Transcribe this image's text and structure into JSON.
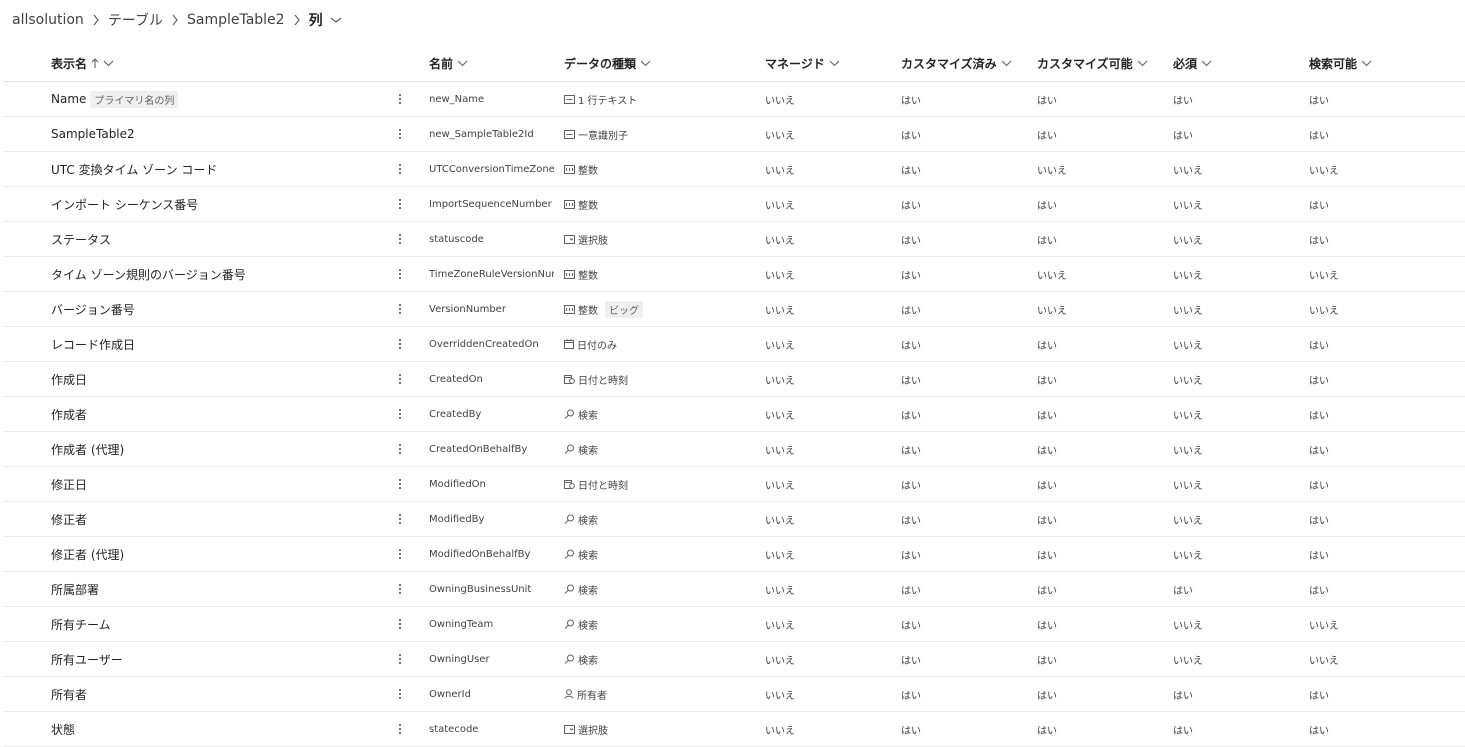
{
  "breadcrumb": {
    "items": [
      "allsolution",
      "テーブル",
      "SampleTable2",
      "列"
    ]
  },
  "columns": {
    "display": "表示名",
    "name": "名前",
    "type": "データの種類",
    "managed": "マネージド",
    "customized": "カスタマイズ済み",
    "customizable": "カスタマイズ可能",
    "required": "必須",
    "searchable": "検索可能"
  },
  "rows": [
    {
      "display": "Name",
      "tag": "プライマリ名の列",
      "name": "new_Name",
      "type_icon": "text-icon",
      "type": "1 行テキスト",
      "type_tag": "",
      "managed": "いいえ",
      "customized": "はい",
      "customizable": "はい",
      "required": "はい",
      "searchable": "はい"
    },
    {
      "display": "SampleTable2",
      "tag": "",
      "name": "new_SampleTable2Id",
      "type_icon": "id-icon",
      "type": "一意識別子",
      "type_tag": "",
      "managed": "いいえ",
      "customized": "はい",
      "customizable": "はい",
      "required": "はい",
      "searchable": "はい"
    },
    {
      "display": "UTC 変換タイム ゾーン コード",
      "tag": "",
      "name": "UTCConversionTimeZoneC...",
      "type_icon": "number-icon",
      "type": "整数",
      "type_tag": "",
      "managed": "いいえ",
      "customized": "はい",
      "customizable": "いいえ",
      "required": "いいえ",
      "searchable": "いいえ"
    },
    {
      "display": "インポート シーケンス番号",
      "tag": "",
      "name": "ImportSequenceNumber",
      "type_icon": "number-icon",
      "type": "整数",
      "type_tag": "",
      "managed": "いいえ",
      "customized": "はい",
      "customizable": "はい",
      "required": "いいえ",
      "searchable": "はい"
    },
    {
      "display": "ステータス",
      "tag": "",
      "name": "statuscode",
      "type_icon": "choice-icon",
      "type": "選択肢",
      "type_tag": "",
      "managed": "いいえ",
      "customized": "はい",
      "customizable": "はい",
      "required": "いいえ",
      "searchable": "はい"
    },
    {
      "display": "タイム ゾーン規則のバージョン番号",
      "tag": "",
      "name": "TimeZoneRuleVersionNum...",
      "type_icon": "number-icon",
      "type": "整数",
      "type_tag": "",
      "managed": "いいえ",
      "customized": "はい",
      "customizable": "いいえ",
      "required": "いいえ",
      "searchable": "いいえ"
    },
    {
      "display": "バージョン番号",
      "tag": "",
      "name": "VersionNumber",
      "type_icon": "number-icon",
      "type": "整数",
      "type_tag": "ビッグ",
      "managed": "いいえ",
      "customized": "はい",
      "customizable": "いいえ",
      "required": "いいえ",
      "searchable": "いいえ"
    },
    {
      "display": "レコード作成日",
      "tag": "",
      "name": "OverriddenCreatedOn",
      "type_icon": "date-icon",
      "type": "日付のみ",
      "type_tag": "",
      "managed": "いいえ",
      "customized": "はい",
      "customizable": "はい",
      "required": "いいえ",
      "searchable": "はい"
    },
    {
      "display": "作成日",
      "tag": "",
      "name": "CreatedOn",
      "type_icon": "datetime-icon",
      "type": "日付と時刻",
      "type_tag": "",
      "managed": "いいえ",
      "customized": "はい",
      "customizable": "はい",
      "required": "いいえ",
      "searchable": "はい"
    },
    {
      "display": "作成者",
      "tag": "",
      "name": "CreatedBy",
      "type_icon": "lookup-icon",
      "type": "検索",
      "type_tag": "",
      "managed": "いいえ",
      "customized": "はい",
      "customizable": "はい",
      "required": "いいえ",
      "searchable": "はい"
    },
    {
      "display": "作成者 (代理)",
      "tag": "",
      "name": "CreatedOnBehalfBy",
      "type_icon": "lookup-icon",
      "type": "検索",
      "type_tag": "",
      "managed": "いいえ",
      "customized": "はい",
      "customizable": "はい",
      "required": "いいえ",
      "searchable": "はい"
    },
    {
      "display": "修正日",
      "tag": "",
      "name": "ModifiedOn",
      "type_icon": "datetime-icon",
      "type": "日付と時刻",
      "type_tag": "",
      "managed": "いいえ",
      "customized": "はい",
      "customizable": "はい",
      "required": "いいえ",
      "searchable": "はい"
    },
    {
      "display": "修正者",
      "tag": "",
      "name": "ModifiedBy",
      "type_icon": "lookup-icon",
      "type": "検索",
      "type_tag": "",
      "managed": "いいえ",
      "customized": "はい",
      "customizable": "はい",
      "required": "いいえ",
      "searchable": "はい"
    },
    {
      "display": "修正者 (代理)",
      "tag": "",
      "name": "ModifiedOnBehalfBy",
      "type_icon": "lookup-icon",
      "type": "検索",
      "type_tag": "",
      "managed": "いいえ",
      "customized": "はい",
      "customizable": "はい",
      "required": "いいえ",
      "searchable": "はい"
    },
    {
      "display": "所属部署",
      "tag": "",
      "name": "OwningBusinessUnit",
      "type_icon": "lookup-icon",
      "type": "検索",
      "type_tag": "",
      "managed": "いいえ",
      "customized": "はい",
      "customizable": "はい",
      "required": "はい",
      "searchable": "はい"
    },
    {
      "display": "所有チーム",
      "tag": "",
      "name": "OwningTeam",
      "type_icon": "lookup-icon",
      "type": "検索",
      "type_tag": "",
      "managed": "いいえ",
      "customized": "はい",
      "customizable": "はい",
      "required": "いいえ",
      "searchable": "いいえ"
    },
    {
      "display": "所有ユーザー",
      "tag": "",
      "name": "OwningUser",
      "type_icon": "lookup-icon",
      "type": "検索",
      "type_tag": "",
      "managed": "いいえ",
      "customized": "はい",
      "customizable": "はい",
      "required": "いいえ",
      "searchable": "いいえ"
    },
    {
      "display": "所有者",
      "tag": "",
      "name": "OwnerId",
      "type_icon": "owner-icon",
      "type": "所有者",
      "type_tag": "",
      "managed": "いいえ",
      "customized": "はい",
      "customizable": "はい",
      "required": "はい",
      "searchable": "はい"
    },
    {
      "display": "状態",
      "tag": "",
      "name": "statecode",
      "type_icon": "choice-icon",
      "type": "選択肢",
      "type_tag": "",
      "managed": "いいえ",
      "customized": "はい",
      "customizable": "はい",
      "required": "はい",
      "searchable": "はい"
    }
  ]
}
